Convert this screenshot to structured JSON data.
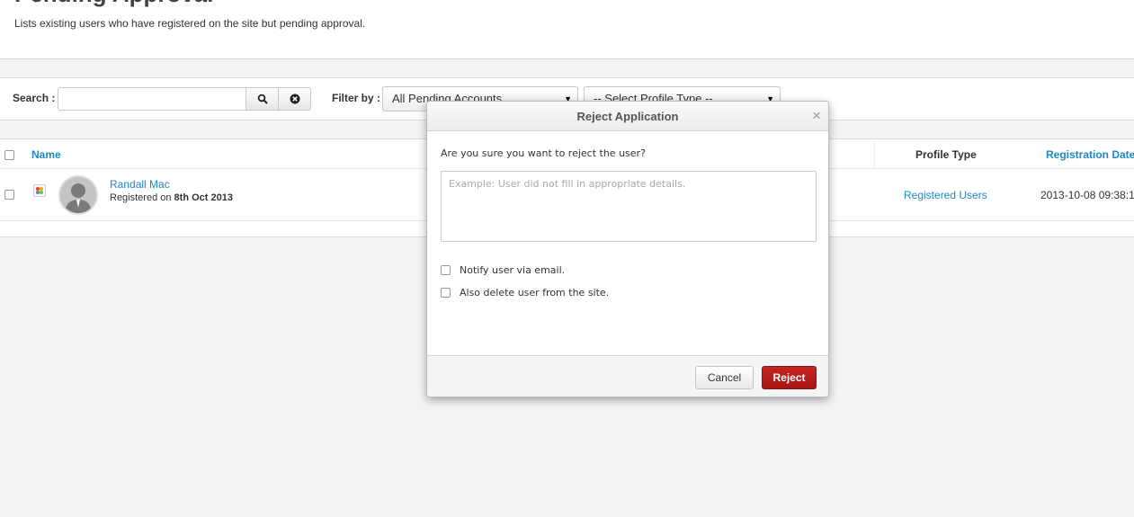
{
  "page": {
    "title": "Pending Approval",
    "description": "Lists existing users who have registered on the site but pending approval."
  },
  "toolbar": {
    "search_label": "Search :",
    "search_value": "",
    "search_placeholder": "",
    "filter_label": "Filter by :",
    "filter_selected": "All Pending Accounts",
    "profile_selected": "-- Select Profile Type --"
  },
  "table": {
    "headers": {
      "name": "Name",
      "profile_type": "Profile Type",
      "registration_date": "Registration Date"
    },
    "rows": [
      {
        "name": "Randall Mac",
        "registered_prefix": "Registered on ",
        "registered_date": "8th Oct 2013",
        "profile_type": "Registered Users",
        "registration_date": "2013-10-08 09:38:1"
      }
    ]
  },
  "modal": {
    "title": "Reject Application",
    "close_glyph": "×",
    "question": "Are you sure you want to reject the user?",
    "textarea_placeholder": "Example: User did not fill in appropriate details.",
    "textarea_value": "",
    "notify_label": "Notify user via email.",
    "notify_checked": false,
    "delete_label": "Also delete user from the site.",
    "delete_checked": false,
    "cancel_label": "Cancel",
    "reject_label": "Reject"
  },
  "colors": {
    "link": "#1e88c7",
    "reject": "#b41c1c",
    "background": "#f4f4f4"
  },
  "icons": {
    "search": "magnifier-icon",
    "clear": "close-circle-icon",
    "dropdown": "caret-down-icon",
    "avatar": "default-avatar-icon",
    "user_type": "joomla-logo-icon"
  }
}
